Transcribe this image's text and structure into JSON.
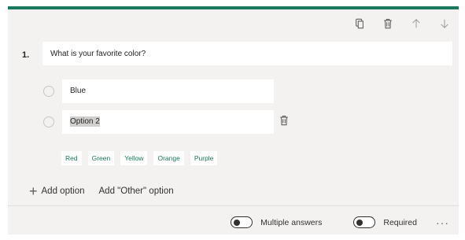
{
  "toolbar": {
    "icons": [
      "copy-icon",
      "trash-icon",
      "arrow-up-icon",
      "arrow-down-icon"
    ]
  },
  "question": {
    "number": "1.",
    "title": "What is your favorite color?"
  },
  "options": [
    {
      "label": "Blue"
    },
    {
      "label": "Option 2"
    }
  ],
  "suggestions": [
    "Red",
    "Green",
    "Yellow",
    "Orange",
    "Purple"
  ],
  "actions": {
    "add_option": "Add option",
    "add_other": "Add \"Other\" option"
  },
  "footer": {
    "multiple_answers": "Multiple answers",
    "required": "Required",
    "more": "···"
  },
  "colors": {
    "accent": "#1b7a5e",
    "card_bg": "#f3f2f1"
  }
}
